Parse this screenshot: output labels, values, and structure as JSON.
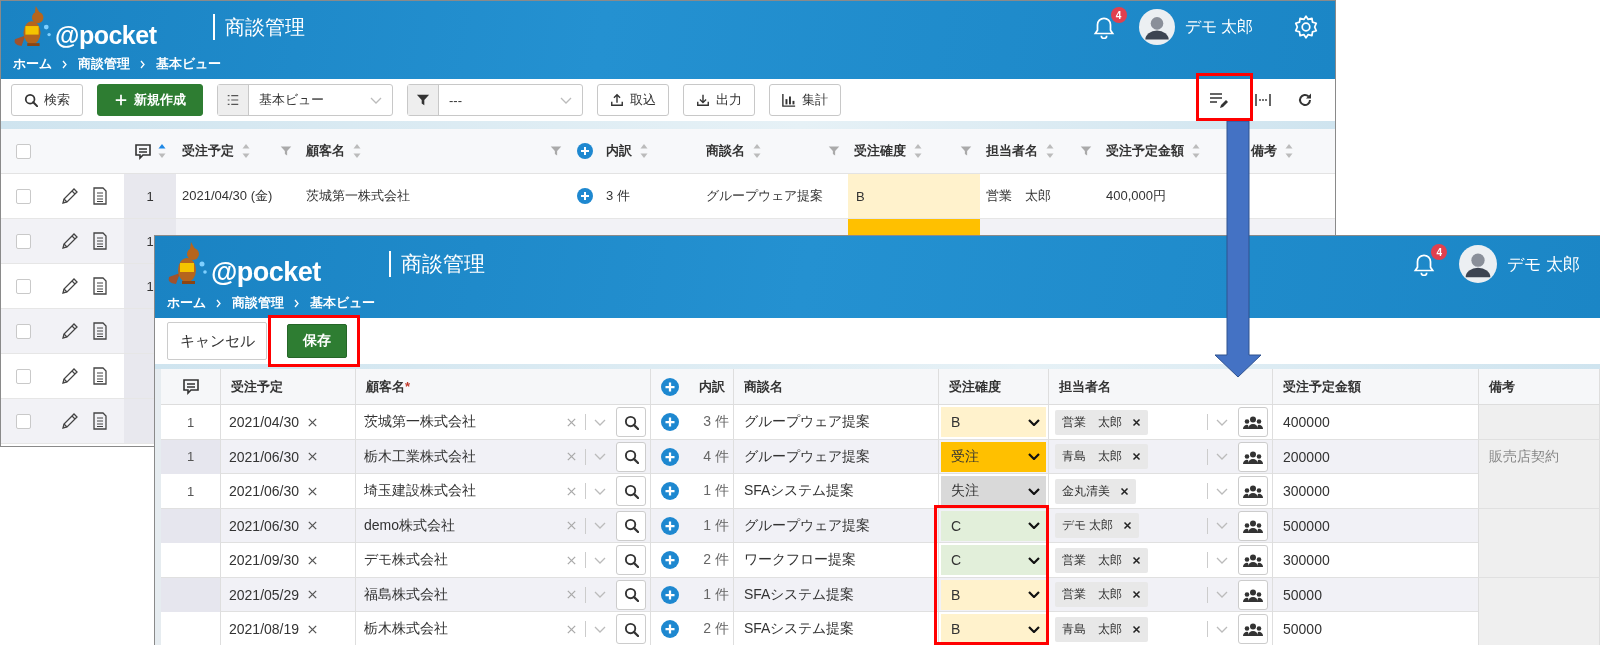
{
  "background_screen": {
    "header": {
      "logo_text": "@pocket",
      "app_title": "商談管理",
      "breadcrumbs": [
        "ホーム",
        "商談管理",
        "基本ビュー"
      ],
      "notification_count": "4",
      "user_name": "デモ 太郎",
      "settings_icon": true
    },
    "toolbar": {
      "search_button": "検索",
      "new_button": "新規作成",
      "view_select": "基本ビュー",
      "filter_select": "---",
      "import_button": "取込",
      "export_button": "出力",
      "summary_button": "集計"
    },
    "table": {
      "select_all_checked": false,
      "comment_sorted_ascending": true,
      "columns": [
        {
          "label": "受注予定",
          "filterable": true
        },
        {
          "label": "顧客名",
          "filterable": true
        },
        {
          "label": "内訳",
          "filterable": false,
          "add_button": true
        },
        {
          "label": "商談名",
          "filterable": true
        },
        {
          "label": "受注確度",
          "filterable": true
        },
        {
          "label": "担当者名",
          "filterable": true
        },
        {
          "label": "受注予定金額",
          "filterable": false
        },
        {
          "label": "備考",
          "filterable": false
        }
      ],
      "rows": [
        {
          "checked": false,
          "count": "1",
          "date": "2021/04/30 (金)",
          "customer": "茨城第一株式会社",
          "details": "3 件",
          "deal": "グループウェア提案",
          "probability": {
            "value": "B",
            "color": "#fff2cc"
          },
          "owner": "営業　太郎",
          "amount": "400,000円"
        },
        {
          "checked": false,
          "count": "1",
          "probability": {
            "color": "#ffc000"
          }
        },
        {
          "checked": false,
          "count": "1"
        },
        {
          "checked": false
        },
        {
          "checked": false
        },
        {
          "checked": false
        }
      ]
    }
  },
  "foreground_screen": {
    "header": {
      "logo_text": "@pocket",
      "app_title": "商談管理",
      "breadcrumbs": [
        "ホーム",
        "商談管理",
        "基本ビュー"
      ],
      "notification_count": "4",
      "user_name": "デモ 太郎"
    },
    "toolbar": {
      "cancel_button": "キャンセル",
      "save_button": "保存"
    },
    "table": {
      "columns": [
        {
          "label": "受注予定"
        },
        {
          "label": "顧客名",
          "required_mark": "*"
        },
        {
          "label": "内訳",
          "add_button": true
        },
        {
          "label": "商談名"
        },
        {
          "label": "受注確度"
        },
        {
          "label": "担当者名"
        },
        {
          "label": "受注予定金額"
        },
        {
          "label": "備考"
        }
      ],
      "rows": [
        {
          "count": "1",
          "date": "2021/04/30",
          "customer": "茨城第一株式会社",
          "details": "3 件",
          "deal": "グループウェア提案",
          "probability": {
            "value": "B",
            "color": "#fff2cc"
          },
          "owner": "営業　太郎",
          "amount": "400000"
        },
        {
          "count": "1",
          "date": "2021/06/30",
          "customer": "栃木工業株式会社",
          "details": "4 件",
          "deal": "グループウェア提案",
          "probability": {
            "value": "受注",
            "color": "#ffc000"
          },
          "owner": "青島　太郎",
          "amount": "200000",
          "note": "販売店契約"
        },
        {
          "count": "1",
          "date": "2021/06/30",
          "customer": "埼玉建設株式会社",
          "details": "1 件",
          "deal": "SFAシステム提案",
          "probability": {
            "value": "失注",
            "color": "#d9d9d9"
          },
          "owner": "金丸清美",
          "amount": "300000"
        },
        {
          "date": "2021/06/30",
          "customer": "demo株式会社",
          "details": "1 件",
          "deal": "グループウェア提案",
          "probability": {
            "value": "C",
            "color": "#e2efda"
          },
          "owner": "デモ 太郎",
          "amount": "500000"
        },
        {
          "date": "2021/09/30",
          "customer": "デモ株式会社",
          "details": "2 件",
          "deal": "ワークフロー提案",
          "probability": {
            "value": "C",
            "color": "#e2efda"
          },
          "owner": "営業　太郎",
          "amount": "300000"
        },
        {
          "date": "2021/05/29",
          "customer": "福島株式会社",
          "details": "1 件",
          "deal": "SFAシステム提案",
          "probability": {
            "value": "B",
            "color": "#fff2cc"
          },
          "owner": "営業　太郎",
          "amount": "50000"
        },
        {
          "date": "2021/08/19",
          "customer": "栃木株式会社",
          "details": "2 件",
          "deal": "SFAシステム提案",
          "probability": {
            "value": "B",
            "color": "#fff2cc"
          },
          "owner": "青島　太郎",
          "amount": "50000"
        }
      ]
    }
  }
}
